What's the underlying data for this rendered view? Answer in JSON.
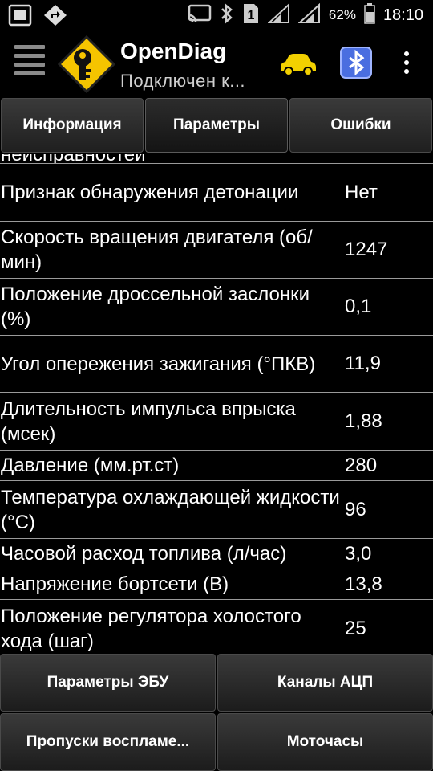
{
  "status_bar": {
    "battery_percent": "62%",
    "time": "18:10",
    "sim_slot": "1",
    "left_icons": [
      "screenshot-icon",
      "warning-navigation-icon"
    ],
    "right_icons": [
      "cast-icon",
      "bluetooth-icon",
      "sim-icon",
      "signal-icon",
      "wifi-signal-icon",
      "battery-icon"
    ]
  },
  "action_bar": {
    "title": "OpenDiag",
    "subtitle": "Подключен к...",
    "icons": [
      "menu-icon",
      "app-logo-key-icon",
      "car-icon",
      "bluetooth-icon",
      "overflow-menu-icon"
    ],
    "colors": {
      "car": "#f2d000",
      "logo_bg": "#f5c400",
      "bluetooth_bg": "#4a6ee0"
    }
  },
  "tabs": [
    {
      "label": "Информация"
    },
    {
      "label": "Параметры"
    },
    {
      "label": "Ошибки"
    }
  ],
  "parameters": {
    "partial_top": "неисправностей",
    "rows": [
      {
        "label": "Признак обнаружения детонации",
        "value": "Нет"
      },
      {
        "label": "Скорость вращения двигателя (об/мин)",
        "value": "1247"
      },
      {
        "label": "Положение дроссельной заслонки (%)",
        "value": "0,1"
      },
      {
        "label": "Угол опережения зажигания (°ПКВ)",
        "value": "11,9"
      },
      {
        "label": "Длительность импульса впрыска (мсек)",
        "value": "1,88"
      },
      {
        "label": "Давление (мм.рт.ст)",
        "value": "280"
      },
      {
        "label": "Температура охлаждающей жидкости (°C)",
        "value": "96"
      },
      {
        "label": "Часовой расход топлива (л/час)",
        "value": "3,0"
      },
      {
        "label": "Напряжение бортсети (В)",
        "value": "13,8"
      },
      {
        "label": "Положение регулятора холостого хода (шаг)",
        "value": "25"
      }
    ]
  },
  "bottom_buttons": [
    {
      "label": "Параметры ЭБУ"
    },
    {
      "label": "Каналы АЦП"
    },
    {
      "label": "Пропуски воспламе..."
    },
    {
      "label": "Моточасы"
    }
  ]
}
